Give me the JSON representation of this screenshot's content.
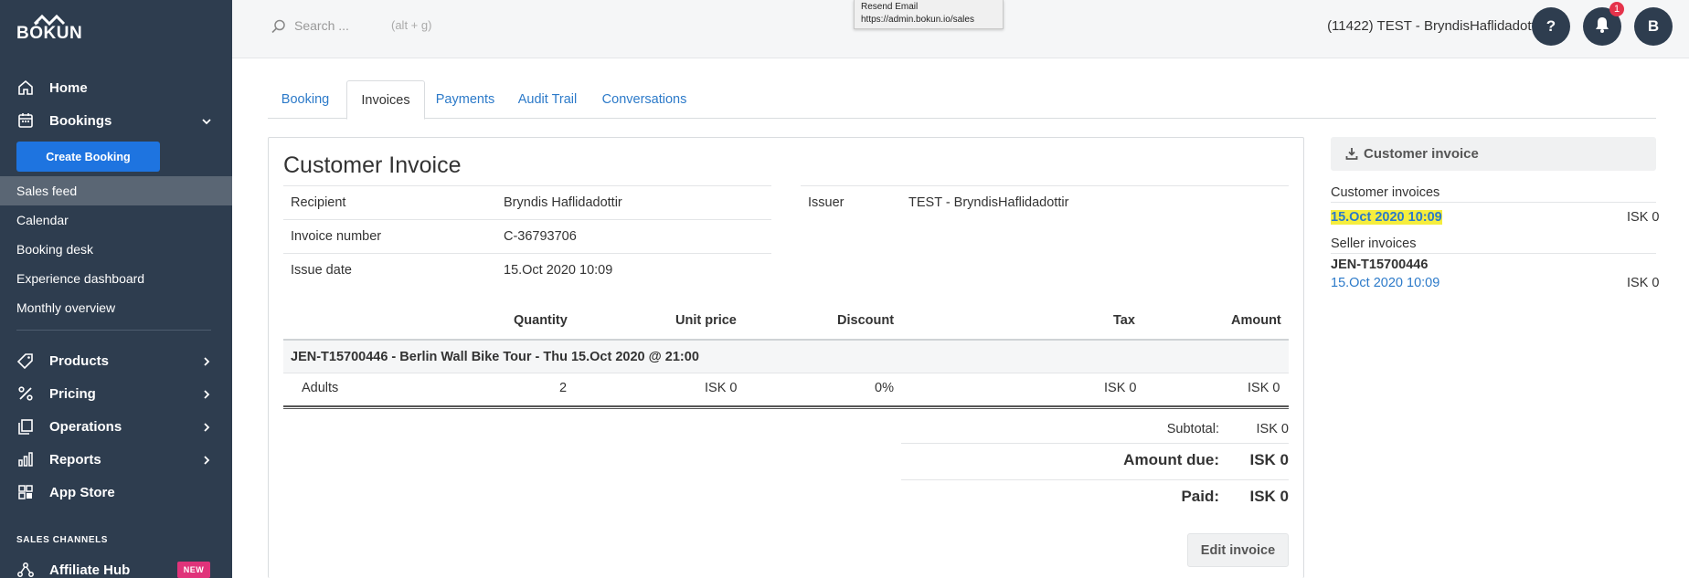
{
  "brand": {
    "logo_text": "BÓKUN"
  },
  "sidebar": {
    "home": "Home",
    "bookings": "Bookings",
    "create_booking": "Create Booking",
    "sub_items": [
      "Sales feed",
      "Calendar",
      "Booking desk",
      "Experience dashboard",
      "Monthly overview"
    ],
    "active_sub_item": "Sales feed",
    "products": "Products",
    "pricing": "Pricing",
    "operations": "Operations",
    "reports": "Reports",
    "app_store": "App Store",
    "sales_channels_label": "SALES CHANNELS",
    "affiliate_hub": "Affiliate Hub",
    "new_badge": "NEW"
  },
  "topbar": {
    "search_placeholder": "Search ...",
    "search_shortcut": "(alt + g)",
    "tooltip_line1": "Resend Email",
    "tooltip_line2": "https://admin.bokun.io/sales",
    "account": "(11422) TEST - BryndisHaflidadottir",
    "help_label": "?",
    "notification_count": "1",
    "avatar_initial": "B"
  },
  "tabs": [
    "Booking",
    "Invoices",
    "Payments",
    "Audit Trail",
    "Conversations"
  ],
  "active_tab": "Invoices",
  "invoice": {
    "title": "Customer Invoice",
    "recipient_label": "Recipient",
    "recipient_value": "Bryndis Haflidadottir",
    "number_label": "Invoice number",
    "number_value": "C-36793706",
    "date_label": "Issue date",
    "date_value": "15.Oct 2020 10:09",
    "issuer_label": "Issuer",
    "issuer_value": "TEST - BryndisHaflidadottir",
    "columns": {
      "quantity": "Quantity",
      "unit_price": "Unit price",
      "discount": "Discount",
      "tax": "Tax",
      "amount": "Amount"
    },
    "group_title": "JEN-T15700446  -  Berlin Wall Bike Tour - Thu 15.Oct 2020 @ 21:00",
    "line": {
      "item": "Adults",
      "quantity": "2",
      "unit_price": "ISK 0",
      "discount": "0%",
      "tax": "ISK 0",
      "amount": "ISK 0"
    },
    "subtotal_label": "Subtotal:",
    "subtotal_value": "ISK 0",
    "amount_due_label": "Amount due:",
    "amount_due_value": "ISK 0",
    "paid_label": "Paid:",
    "paid_value": "ISK 0",
    "edit_button": "Edit invoice"
  },
  "right_panel": {
    "download_button": "Customer invoice",
    "customer_invoices_label": "Customer invoices",
    "customer_invoice_date": "15.Oct 2020 10:09",
    "customer_invoice_amount": "ISK 0",
    "seller_invoices_label": "Seller invoices",
    "seller_ref": "JEN-T15700446",
    "seller_invoice_date": "15.Oct 2020 10:09",
    "seller_invoice_amount": "ISK 0"
  },
  "colors": {
    "sidebar_bg": "#2e3d4f",
    "link": "#2c7ac9",
    "primary_button": "#1e74e0",
    "badge": "#e0337a",
    "highlight": "#f5ed3d"
  }
}
